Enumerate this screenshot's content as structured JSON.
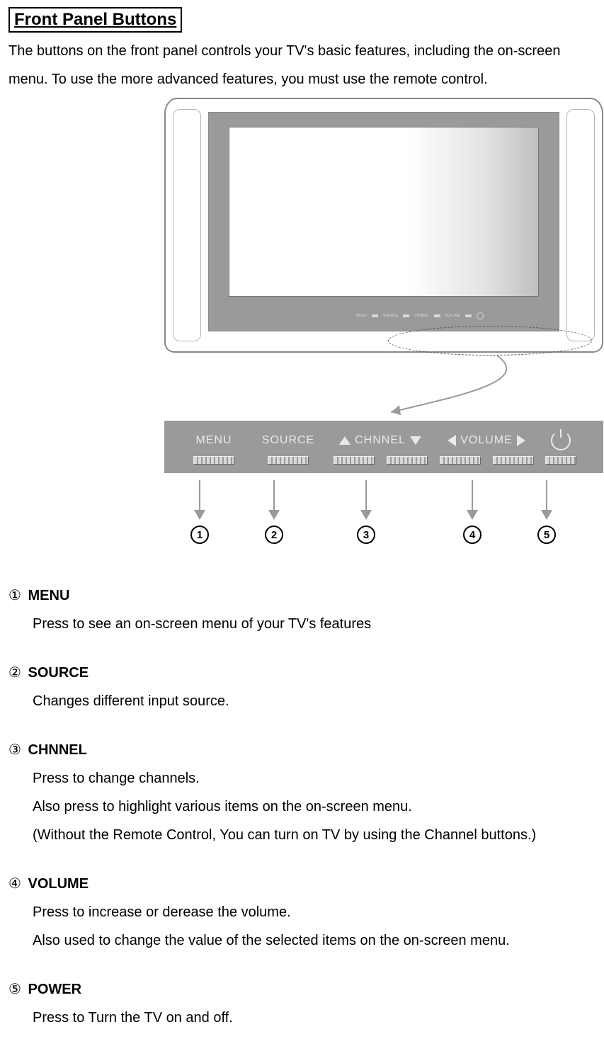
{
  "title": "Front Panel Buttons",
  "intro": "The buttons on the front panel controls your TV's basic features, including the on-screen menu. To use the more advanced features, you must use the remote control.",
  "panel": {
    "menu": "MENU",
    "source": "SOURCE",
    "channel": "CHNNEL",
    "volume": "VOLUME"
  },
  "tiny_panel": {
    "menu": "MENU",
    "source": "SOURCE",
    "channel": "CHNNEL",
    "volume": "VOLUME"
  },
  "numbers": [
    "1",
    "2",
    "3",
    "4",
    "5"
  ],
  "defs": [
    {
      "glyph": "①",
      "name": "MENU",
      "lines": [
        "Press to see an on-screen menu of your TV's features"
      ]
    },
    {
      "glyph": "②",
      "name": "SOURCE",
      "lines": [
        "Changes different input source."
      ]
    },
    {
      "glyph": "③",
      "name": "CHNNEL",
      "lines": [
        "Press to change channels.",
        "Also press to highlight various items on the on-screen menu.",
        "(Without the Remote Control, You can turn on TV by using the Channel buttons.)"
      ]
    },
    {
      "glyph": "④",
      "name": "VOLUME",
      "lines": [
        "Press to increase or derease the volume.",
        "Also used to change the value of the selected items on the on-screen menu."
      ]
    },
    {
      "glyph": "⑤",
      "name": "POWER",
      "lines": [
        "Press to Turn the TV on and off."
      ]
    }
  ]
}
